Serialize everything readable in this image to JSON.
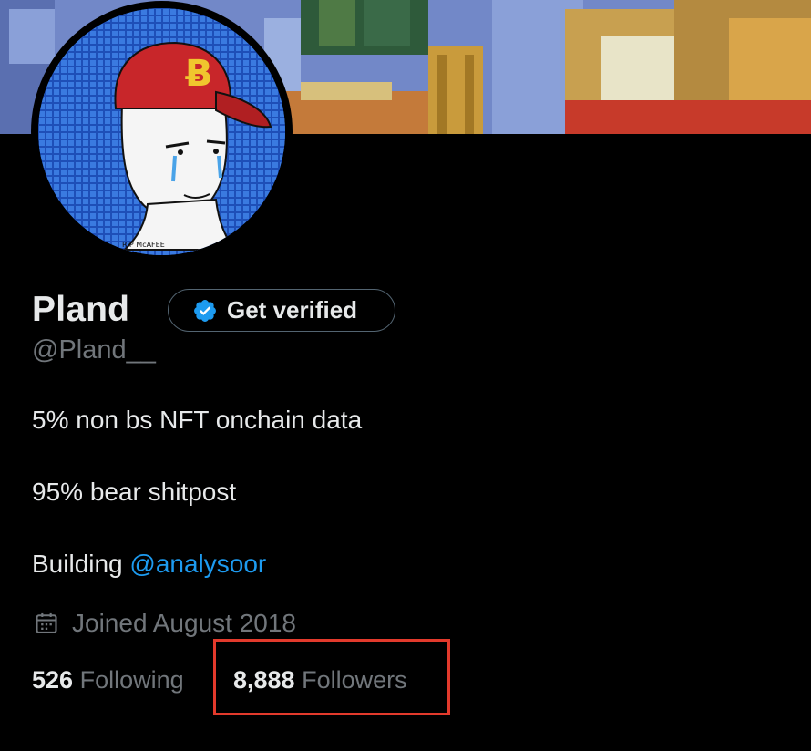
{
  "profile": {
    "name": "Pland",
    "verify_label": "Get verified",
    "handle": "@Pland__",
    "avatar_signature": "RIP McAFEE",
    "cap_emblem": "Ƀ",
    "bio_lines": [
      "5% non bs NFT onchain data",
      "95% bear shitpost"
    ],
    "bio_building_prefix": "Building ",
    "bio_mention": "@analysoor",
    "joined": "Joined August 2018",
    "following_count": "526",
    "following_label": "Following",
    "followers_count": "8,888",
    "followers_label": "Followers"
  },
  "icons": {
    "verify": "verified-badge-icon",
    "joined": "calendar-icon"
  },
  "colors": {
    "background": "#000000",
    "text": "#e7e9ea",
    "muted": "#71767b",
    "link": "#1d9bf0",
    "highlight_box": "#e23a2c",
    "badge": "#1d9bf0"
  }
}
